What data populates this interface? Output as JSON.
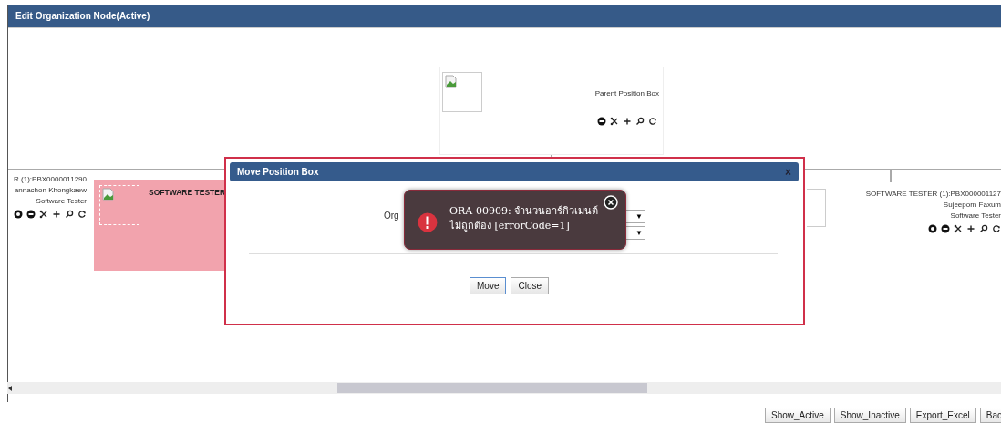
{
  "window": {
    "title": "Edit Organization Node(Active)"
  },
  "nodes": [
    {
      "kind": "parent",
      "highlighted": false,
      "lines": [
        "Parent Position Box"
      ]
    },
    {
      "kind": "left",
      "highlighted": false,
      "lines": [
        "R (1):PBX0000011290",
        "annachon Khongkaew",
        "Software Tester"
      ]
    },
    {
      "kind": "center",
      "highlighted": true,
      "lines": [
        "SOFTWARE TESTER"
      ]
    },
    {
      "kind": "right",
      "highlighted": false,
      "lines": [
        "SOFTWARE TESTER (1):PBX000001127",
        "Sujeeporn Faxum",
        "Software Tester"
      ]
    }
  ],
  "dialog": {
    "title": "Move Position Box",
    "close": "×",
    "label": "Org",
    "dropdowns": [
      {
        "arrow": "▼"
      },
      {
        "arrow": "▼"
      }
    ],
    "buttons": [
      {
        "label": "Move",
        "focused": true
      },
      {
        "label": "Close",
        "focused": false
      }
    ]
  },
  "error": {
    "message": "ORA-00909: จำนวนอาร์กิวเมนต์ไม่ถูกต้อง  [errorCode=1]"
  },
  "footer_buttons": [
    "Show_Active",
    "Show_Inactive",
    "Export_Excel",
    "Bac"
  ]
}
